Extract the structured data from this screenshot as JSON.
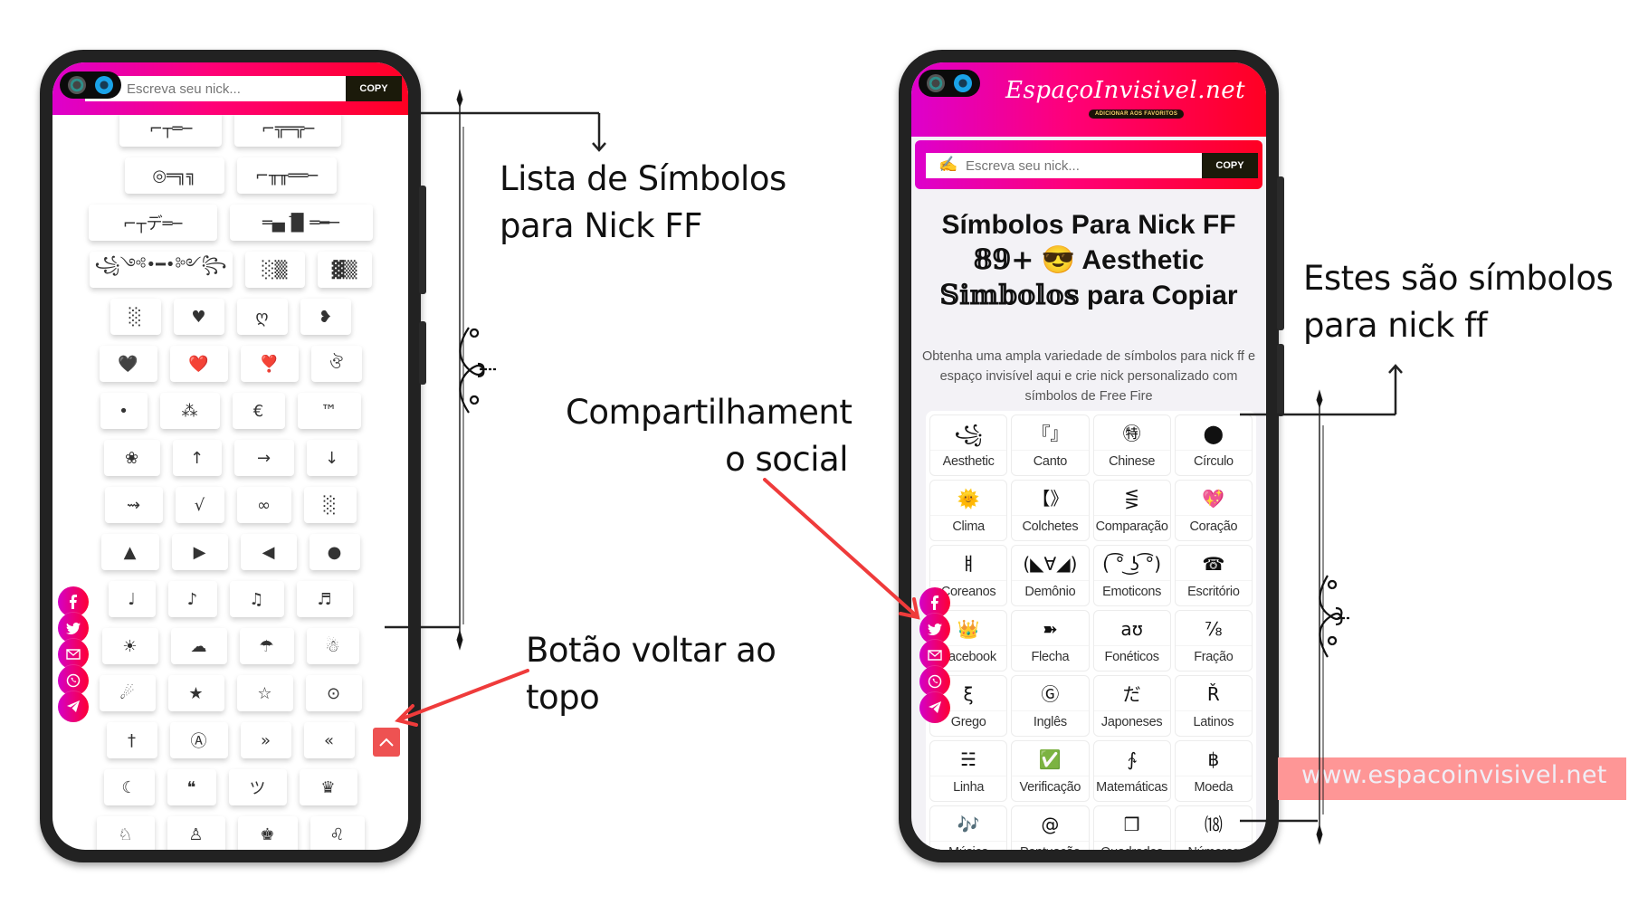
{
  "left_phone": {
    "nick_placeholder": "Escreva seu nick...",
    "copy_label": "COPY",
    "symbol_rows": [
      [
        "⌐┬═─",
        "⌐╦═╦─"
      ],
      [
        "◎═╗╗",
        "⌐╥╥══─"
      ],
      [
        "⌐┬デ═─",
        "═▄▐̅▌═━─"
      ],
      [
        "꧁༺•━•༻꧂",
        "░▒",
        "▓▒"
      ],
      [
        "░",
        "♥",
        "ღ",
        "❥"
      ],
      [
        "🖤",
        "❤️",
        "❣️",
        "ঔ"
      ],
      [
        "•",
        "⁂",
        "€",
        "™"
      ],
      [
        "❀",
        "↑",
        "→",
        "↓"
      ],
      [
        "⇝",
        "√",
        "∞",
        "░"
      ],
      [
        "▲",
        "▶",
        "◀",
        "●"
      ],
      [
        "♩",
        "♪",
        "♫",
        "♬"
      ],
      [
        "☀",
        "☁",
        "☂",
        "☃"
      ],
      [
        "☄",
        "★",
        "☆",
        "⊙"
      ],
      [
        "†",
        "Ⓐ",
        "»",
        "«"
      ],
      [
        "☾",
        "❝",
        "ツ",
        "♛"
      ],
      [
        "♘",
        "♙",
        "♚",
        "♌"
      ]
    ],
    "back_to_top_icon": "chevron-up-icon"
  },
  "social_share": [
    {
      "name": "facebook",
      "icon": "facebook-icon"
    },
    {
      "name": "twitter",
      "icon": "twitter-icon"
    },
    {
      "name": "email",
      "icon": "email-icon"
    },
    {
      "name": "whatsapp",
      "icon": "whatsapp-icon"
    },
    {
      "name": "telegram",
      "icon": "telegram-icon"
    }
  ],
  "right_phone": {
    "logo": "EspaçoInvisivel.net",
    "logo_badge": "ADICIONAR AOS FAVORITOS",
    "nick_placeholder": "Escreva seu nick...",
    "copy_label": "COPY",
    "title_line1": "Símbolos Para Nick FF",
    "title_line2_num": "𝟠𝟡+",
    "title_line2_emoji": "😎",
    "title_line2_rest": "Aesthetic",
    "title_line3_styled": "𝕊𝕚𝕞𝕓𝕠𝕝𝕠𝕤",
    "title_line3_rest": "para Copiar",
    "description": "Obtenha uma ampla variedade de símbolos para nick ff e espaço invisível aqui e crie nick personalizado com símbolos de Free Fire",
    "categories": [
      {
        "icon": "꧁",
        "label": "Aesthetic"
      },
      {
        "icon": "『』",
        "label": "Canto"
      },
      {
        "icon": "㊕",
        "label": "Chinese"
      },
      {
        "icon": "⬤",
        "label": "Círculo"
      },
      {
        "icon": "🌞",
        "label": "Clima"
      },
      {
        "icon": "【》",
        "label": "Colchetes"
      },
      {
        "icon": "⋚",
        "label": "Comparação"
      },
      {
        "icon": "💖",
        "label": "Coração"
      },
      {
        "icon": "ㅒ",
        "label": "Coreanos"
      },
      {
        "icon": "(◣∀◢)",
        "label": "Demônio"
      },
      {
        "icon": "( ͡° ͜ʖ ͡°)",
        "label": "Emoticons"
      },
      {
        "icon": "☎",
        "label": "Escritório"
      },
      {
        "icon": "👑",
        "label": "Facebook"
      },
      {
        "icon": "➽",
        "label": "Flecha"
      },
      {
        "icon": "aʊ",
        "label": "Fonéticos"
      },
      {
        "icon": "⅞",
        "label": "Fração"
      },
      {
        "icon": "ξ",
        "label": "Grego"
      },
      {
        "icon": "Ⓖ",
        "label": "Inglês"
      },
      {
        "icon": "だ",
        "label": "Japoneses"
      },
      {
        "icon": "Ř",
        "label": "Latinos"
      },
      {
        "icon": "☵",
        "label": "Linha"
      },
      {
        "icon": "✅",
        "label": "Verificação"
      },
      {
        "icon": "∱",
        "label": "Matemáticas"
      },
      {
        "icon": "฿",
        "label": "Moeda"
      },
      {
        "icon": "🎶",
        "label": "Música"
      },
      {
        "icon": "@",
        "label": "Pontuação"
      },
      {
        "icon": "❒",
        "label": "Quadrados"
      },
      {
        "icon": "⒅",
        "label": "Números"
      }
    ]
  },
  "annotations": {
    "symbol_list_line1": "Lista de Símbolos",
    "symbol_list_line2": "para Nick FF",
    "back_top_line1": "Botão voltar ao",
    "back_top_line2": "topo",
    "social_line1": "Compartilhament",
    "social_line2": "o social",
    "symbols_line1": "Estes são símbolos",
    "symbols_line2": "para nick ff",
    "website": "www.espacoinvisivel.net"
  },
  "colors": {
    "gradient_start": "#dd00cc",
    "gradient_end": "#ff0022",
    "copy_button": "#1b1a0a",
    "back_to_top": "#ee5252",
    "arrow_red": "#ef3b3b",
    "url_band": "#fe9696"
  }
}
